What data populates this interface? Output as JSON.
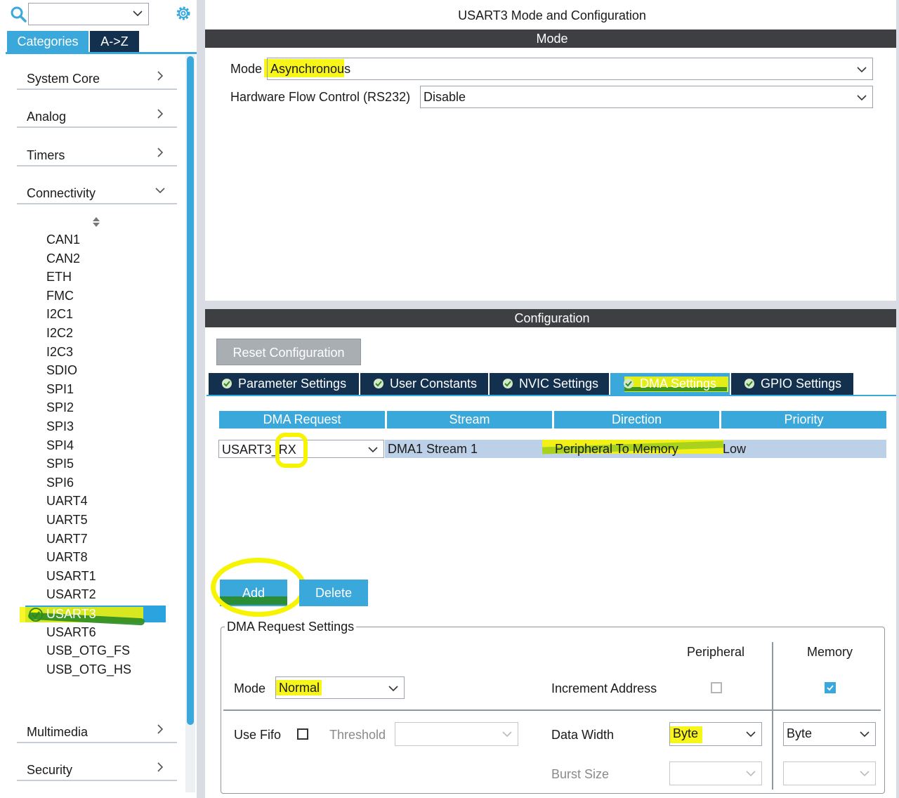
{
  "sidebar": {
    "search_value": "",
    "tabs": {
      "categories": "Categories",
      "az": "A->Z"
    },
    "categories_top": [
      "System Core",
      "Analog",
      "Timers",
      "Connectivity"
    ],
    "connectivity_items": [
      "CAN1",
      "CAN2",
      "ETH",
      "FMC",
      "I2C1",
      "I2C2",
      "I2C3",
      "SDIO",
      "SPI1",
      "SPI2",
      "SPI3",
      "SPI4",
      "SPI5",
      "SPI6",
      "UART4",
      "UART5",
      "UART7",
      "UART8",
      "USART1",
      "USART2",
      "USART3",
      "USART6",
      "USB_OTG_FS",
      "USB_OTG_HS"
    ],
    "selected_item": "USART3",
    "categories_bottom": [
      "Multimedia",
      "Security"
    ]
  },
  "main": {
    "title": "USART3 Mode and Configuration",
    "mode_band": "Mode",
    "mode": {
      "label": "Mode",
      "value": "Asynchronous"
    },
    "flow": {
      "label": "Hardware Flow Control (RS232)",
      "value": "Disable"
    },
    "config_band": "Configuration",
    "reset_button": "Reset Configuration",
    "tabs": [
      {
        "label": "Parameter Settings"
      },
      {
        "label": "User Constants"
      },
      {
        "label": "NVIC Settings"
      },
      {
        "label": "DMA Settings"
      },
      {
        "label": "GPIO Settings"
      }
    ],
    "active_tab": "DMA Settings",
    "dma_table": {
      "headers": [
        "DMA Request",
        "Stream",
        "Direction",
        "Priority"
      ],
      "rows": [
        {
          "request": "USART3_RX",
          "stream": "DMA1 Stream 1",
          "direction": "Peripheral To Memory",
          "priority": "Low"
        }
      ]
    },
    "add_button": "Add",
    "delete_button": "Delete",
    "dma_settings": {
      "legend": "DMA Request Settings",
      "peripheral_header": "Peripheral",
      "memory_header": "Memory",
      "mode_label": "Mode",
      "mode_value": "Normal",
      "increment_label": "Increment Address",
      "increment_peripheral": false,
      "increment_memory": true,
      "use_fifo_label": "Use Fifo",
      "use_fifo": false,
      "threshold_label": "Threshold",
      "threshold_value": "",
      "data_width_label": "Data Width",
      "data_width_peripheral": "Byte",
      "data_width_memory": "Byte",
      "burst_size_label": "Burst Size",
      "burst_peripheral": "",
      "burst_memory": ""
    }
  },
  "colors": {
    "accent": "#3aa8db",
    "navy": "#13304f",
    "band": "#3d3f42",
    "highlight": "#f6f400",
    "marker_green": "#2a8b24"
  }
}
